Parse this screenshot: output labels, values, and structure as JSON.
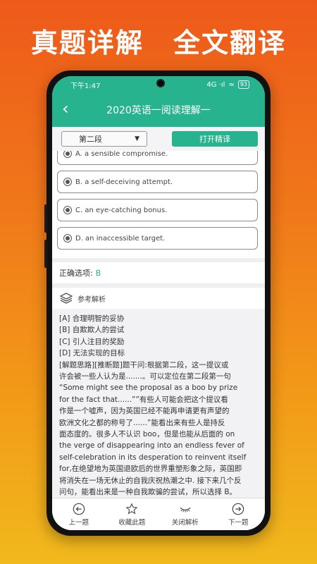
{
  "promo": {
    "left_title": "真题详解",
    "right_title": "全文翻译"
  },
  "status_bar": {
    "time": "下午1:47",
    "signal": "4G ·ıl",
    "battery": "93"
  },
  "header": {
    "back_icon": "chevron-left-icon",
    "title": "2020英语一阅读理解一"
  },
  "toolbar": {
    "paragraph_select": "第二段",
    "translate_button": "打开精译"
  },
  "options": [
    {
      "label": "A. a sensible compromise."
    },
    {
      "label": "B. a self-deceiving attempt."
    },
    {
      "label": "C. an eye-catching bonus."
    },
    {
      "label": "D. an inaccessible target."
    }
  ],
  "answer": {
    "label": "正确选项:",
    "value": "B"
  },
  "analysis": {
    "title": "参考解析",
    "lines": [
      "[A] 合理明智的妥协",
      "[B] 自欺欺人的尝试",
      "[C] 引人注目的奖励",
      "[D] 无法实现的目标",
      "[解题思路][推断题]题干问:根据第二段，这一提议或",
      "许会被一些人认为是.......。可以定位在第二段第一句",
      "“Some might see the proposal as a boo by prize",
      "for the fact that......””有些人可能会把这个提议看",
      "作是一个嘘声，因为英国已经不能再申请更有声望的",
      "欧洲文化之都的称号了......”能看出来有些人是持反",
      "面态度的。很多人不认识 boo，但是也能从后面的 on",
      "the verge of disappearing into an endless fever of",
      "self-celebration in its desperation to reinvent itself",
      "for,在绝望地为英国退欧后的世界重塑形象之际，英国即",
      "将消失在一场无休止的自我庆祝热潮之中. 接下来几个反",
      "问句，能看出来是一种自我欺骗的尝试，所以选择 B。"
    ]
  },
  "bottom_nav": [
    {
      "label": "上一题",
      "icon": "arrow-left-circle-icon"
    },
    {
      "label": "收藏此题",
      "icon": "star-outline-icon"
    },
    {
      "label": "关闭解析",
      "icon": "closed-eye-icon"
    },
    {
      "label": "下一题",
      "icon": "arrow-right-circle-icon"
    }
  ],
  "colors": {
    "accent": "#27b38d",
    "background_top": "#ee5a1a",
    "background_bottom": "#f1b91c"
  }
}
